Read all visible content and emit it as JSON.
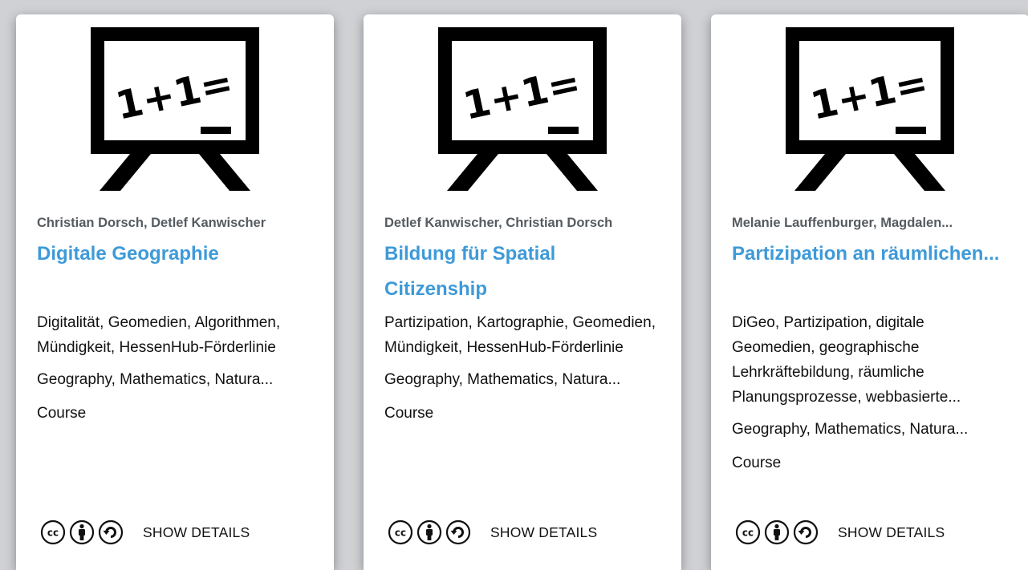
{
  "cards": [
    {
      "authors": "Christian Dorsch, Detlef Kanwischer",
      "title": "Digitale Geographie",
      "keywords": "Digitalität, Geomedien, Algorithmen, Mündigkeit, HessenHub-Förderlinie",
      "subjects": "Geography, Mathematics, Natura...",
      "type": "Course",
      "details_label": "SHOW DETAILS"
    },
    {
      "authors": "Detlef Kanwischer, Christian Dorsch",
      "title": "Bildung für Spatial Citizenship",
      "keywords": "Partizipation, Kartographie, Geomedien, Mündigkeit, HessenHub-Förderlinie",
      "subjects": "Geography, Mathematics, Natura...",
      "type": "Course",
      "details_label": "SHOW DETAILS"
    },
    {
      "authors": "Melanie Lauffenburger, Magdalen...",
      "title": "Partizipation an räumlichen...",
      "keywords": "DiGeo, Partizipation, digitale Geomedien, geographische Lehrkräftebildung, räumliche Planungsprozesse, webbasierte...",
      "subjects": "Geography, Mathematics, Natura...",
      "type": "Course",
      "details_label": "SHOW DETAILS"
    }
  ],
  "thumbnail_text": "1+1=",
  "license_icons": [
    "cc-icon",
    "by-icon",
    "sa-icon"
  ],
  "colors": {
    "title": "#3e9ad8",
    "background": "#cfd1d4",
    "card": "#ffffff"
  }
}
